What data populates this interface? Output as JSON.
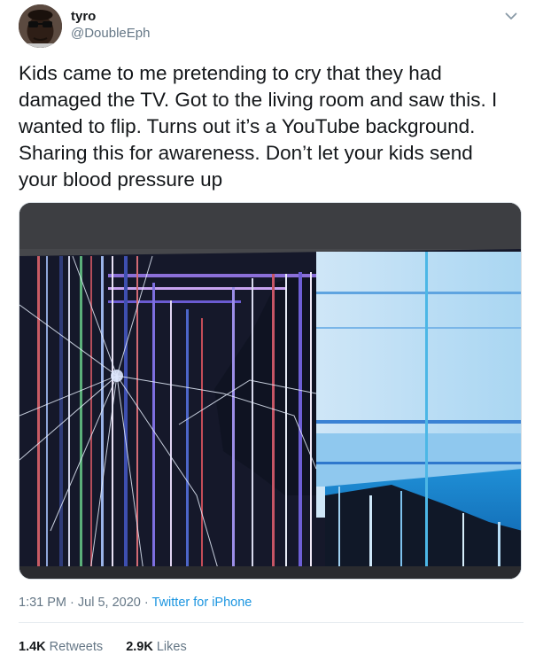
{
  "author": {
    "name": "tyro",
    "handle": "@DoubleEph"
  },
  "tweet": {
    "text": "Kids came to me pretending to cry that they had\ndamaged the TV. Got to the living room and saw this. I\nwanted to flip. Turns out it’s a YouTube background.\nSharing this for awareness. Don’t let your kids send\nyour blood pressure up",
    "time": "1:31 PM",
    "separator": "·",
    "date": "Jul 5, 2020",
    "source": "Twitter for iPhone"
  },
  "stats": {
    "retweets_count": "1.4K",
    "retweets_label": "Retweets",
    "likes_count": "2.9K",
    "likes_label": "Likes"
  },
  "icons": {
    "menu": "chevron-down-icon"
  },
  "colors": {
    "text": "#14171a",
    "secondary": "#657786",
    "link": "#1b95e0",
    "divider": "#e6ecf0"
  }
}
